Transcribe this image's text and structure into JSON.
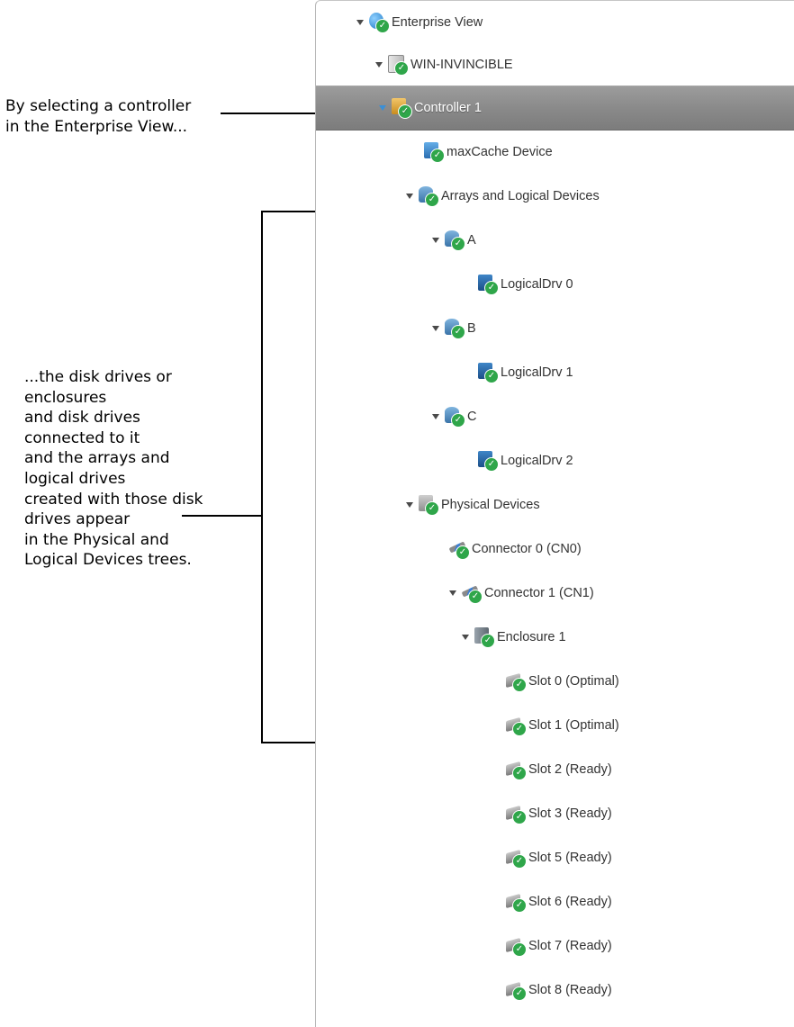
{
  "annotations": {
    "selection_note": [
      "By selecting a controller",
      "in the Enterprise View..."
    ],
    "result_note": [
      "...the disk drives or",
      "enclosures",
      "and disk drives",
      "connected to it",
      "and the arrays and",
      "logical drives",
      "created with those disk",
      "drives appear",
      "in the Physical and",
      "Logical Devices trees."
    ]
  },
  "tree": {
    "items": [
      {
        "label": "Enterprise View",
        "icon": "globe-icon",
        "expanded": true,
        "selected": false
      },
      {
        "label": "WIN-INVINCIBLE",
        "icon": "server-icon",
        "expanded": true,
        "selected": false
      },
      {
        "label": "Controller 1",
        "icon": "controller-icon",
        "expanded": true,
        "selected": true
      },
      {
        "label": "maxCache Device",
        "icon": "maxcache-icon",
        "expanded": null,
        "selected": false
      },
      {
        "label": "Arrays and Logical Devices",
        "icon": "arrays-icon",
        "expanded": true,
        "selected": false
      },
      {
        "label": "A",
        "icon": "array-icon",
        "expanded": true,
        "selected": false
      },
      {
        "label": "LogicalDrv 0",
        "icon": "logical-drive-icon",
        "expanded": null,
        "selected": false
      },
      {
        "label": "B",
        "icon": "array-icon",
        "expanded": true,
        "selected": false
      },
      {
        "label": "LogicalDrv 1",
        "icon": "logical-drive-icon",
        "expanded": null,
        "selected": false
      },
      {
        "label": "C",
        "icon": "array-icon",
        "expanded": true,
        "selected": false
      },
      {
        "label": "LogicalDrv 2",
        "icon": "logical-drive-icon",
        "expanded": null,
        "selected": false
      },
      {
        "label": "Physical Devices",
        "icon": "physical-devices-icon",
        "expanded": true,
        "selected": false
      },
      {
        "label": "Connector 0 (CN0)",
        "icon": "connector-icon",
        "expanded": null,
        "selected": false
      },
      {
        "label": "Connector 1 (CN1)",
        "icon": "connector-icon",
        "expanded": true,
        "selected": false
      },
      {
        "label": "Enclosure 1",
        "icon": "enclosure-icon",
        "expanded": true,
        "selected": false
      },
      {
        "label": "Slot 0 (Optimal)",
        "icon": "disk-drive-icon",
        "expanded": null,
        "selected": false
      },
      {
        "label": "Slot 1 (Optimal)",
        "icon": "disk-drive-icon",
        "expanded": null,
        "selected": false
      },
      {
        "label": "Slot 2 (Ready)",
        "icon": "disk-drive-icon",
        "expanded": null,
        "selected": false
      },
      {
        "label": "Slot 3 (Ready)",
        "icon": "disk-drive-icon",
        "expanded": null,
        "selected": false
      },
      {
        "label": "Slot 5 (Ready)",
        "icon": "disk-drive-icon",
        "expanded": null,
        "selected": false
      },
      {
        "label": "Slot 6 (Ready)",
        "icon": "disk-drive-icon",
        "expanded": null,
        "selected": false
      },
      {
        "label": "Slot 7 (Ready)",
        "icon": "disk-drive-icon",
        "expanded": null,
        "selected": false
      },
      {
        "label": "Slot 8 (Ready)",
        "icon": "disk-drive-icon",
        "expanded": null,
        "selected": false
      }
    ]
  },
  "colors": {
    "selected_row": "#8a8a8a",
    "status_ok": "#2fa64a",
    "expander_selected": "#3a8fd6"
  }
}
